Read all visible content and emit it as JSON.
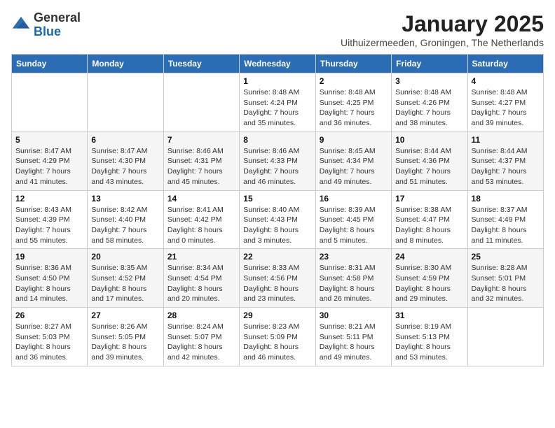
{
  "logo": {
    "general": "General",
    "blue": "Blue"
  },
  "header": {
    "month": "January 2025",
    "location": "Uithuizermeeden, Groningen, The Netherlands"
  },
  "weekdays": [
    "Sunday",
    "Monday",
    "Tuesday",
    "Wednesday",
    "Thursday",
    "Friday",
    "Saturday"
  ],
  "weeks": [
    [
      {
        "day": "",
        "info": ""
      },
      {
        "day": "",
        "info": ""
      },
      {
        "day": "",
        "info": ""
      },
      {
        "day": "1",
        "info": "Sunrise: 8:48 AM\nSunset: 4:24 PM\nDaylight: 7 hours\nand 35 minutes."
      },
      {
        "day": "2",
        "info": "Sunrise: 8:48 AM\nSunset: 4:25 PM\nDaylight: 7 hours\nand 36 minutes."
      },
      {
        "day": "3",
        "info": "Sunrise: 8:48 AM\nSunset: 4:26 PM\nDaylight: 7 hours\nand 38 minutes."
      },
      {
        "day": "4",
        "info": "Sunrise: 8:48 AM\nSunset: 4:27 PM\nDaylight: 7 hours\nand 39 minutes."
      }
    ],
    [
      {
        "day": "5",
        "info": "Sunrise: 8:47 AM\nSunset: 4:29 PM\nDaylight: 7 hours\nand 41 minutes."
      },
      {
        "day": "6",
        "info": "Sunrise: 8:47 AM\nSunset: 4:30 PM\nDaylight: 7 hours\nand 43 minutes."
      },
      {
        "day": "7",
        "info": "Sunrise: 8:46 AM\nSunset: 4:31 PM\nDaylight: 7 hours\nand 45 minutes."
      },
      {
        "day": "8",
        "info": "Sunrise: 8:46 AM\nSunset: 4:33 PM\nDaylight: 7 hours\nand 46 minutes."
      },
      {
        "day": "9",
        "info": "Sunrise: 8:45 AM\nSunset: 4:34 PM\nDaylight: 7 hours\nand 49 minutes."
      },
      {
        "day": "10",
        "info": "Sunrise: 8:44 AM\nSunset: 4:36 PM\nDaylight: 7 hours\nand 51 minutes."
      },
      {
        "day": "11",
        "info": "Sunrise: 8:44 AM\nSunset: 4:37 PM\nDaylight: 7 hours\nand 53 minutes."
      }
    ],
    [
      {
        "day": "12",
        "info": "Sunrise: 8:43 AM\nSunset: 4:39 PM\nDaylight: 7 hours\nand 55 minutes."
      },
      {
        "day": "13",
        "info": "Sunrise: 8:42 AM\nSunset: 4:40 PM\nDaylight: 7 hours\nand 58 minutes."
      },
      {
        "day": "14",
        "info": "Sunrise: 8:41 AM\nSunset: 4:42 PM\nDaylight: 8 hours\nand 0 minutes."
      },
      {
        "day": "15",
        "info": "Sunrise: 8:40 AM\nSunset: 4:43 PM\nDaylight: 8 hours\nand 3 minutes."
      },
      {
        "day": "16",
        "info": "Sunrise: 8:39 AM\nSunset: 4:45 PM\nDaylight: 8 hours\nand 5 minutes."
      },
      {
        "day": "17",
        "info": "Sunrise: 8:38 AM\nSunset: 4:47 PM\nDaylight: 8 hours\nand 8 minutes."
      },
      {
        "day": "18",
        "info": "Sunrise: 8:37 AM\nSunset: 4:49 PM\nDaylight: 8 hours\nand 11 minutes."
      }
    ],
    [
      {
        "day": "19",
        "info": "Sunrise: 8:36 AM\nSunset: 4:50 PM\nDaylight: 8 hours\nand 14 minutes."
      },
      {
        "day": "20",
        "info": "Sunrise: 8:35 AM\nSunset: 4:52 PM\nDaylight: 8 hours\nand 17 minutes."
      },
      {
        "day": "21",
        "info": "Sunrise: 8:34 AM\nSunset: 4:54 PM\nDaylight: 8 hours\nand 20 minutes."
      },
      {
        "day": "22",
        "info": "Sunrise: 8:33 AM\nSunset: 4:56 PM\nDaylight: 8 hours\nand 23 minutes."
      },
      {
        "day": "23",
        "info": "Sunrise: 8:31 AM\nSunset: 4:58 PM\nDaylight: 8 hours\nand 26 minutes."
      },
      {
        "day": "24",
        "info": "Sunrise: 8:30 AM\nSunset: 4:59 PM\nDaylight: 8 hours\nand 29 minutes."
      },
      {
        "day": "25",
        "info": "Sunrise: 8:28 AM\nSunset: 5:01 PM\nDaylight: 8 hours\nand 32 minutes."
      }
    ],
    [
      {
        "day": "26",
        "info": "Sunrise: 8:27 AM\nSunset: 5:03 PM\nDaylight: 8 hours\nand 36 minutes."
      },
      {
        "day": "27",
        "info": "Sunrise: 8:26 AM\nSunset: 5:05 PM\nDaylight: 8 hours\nand 39 minutes."
      },
      {
        "day": "28",
        "info": "Sunrise: 8:24 AM\nSunset: 5:07 PM\nDaylight: 8 hours\nand 42 minutes."
      },
      {
        "day": "29",
        "info": "Sunrise: 8:23 AM\nSunset: 5:09 PM\nDaylight: 8 hours\nand 46 minutes."
      },
      {
        "day": "30",
        "info": "Sunrise: 8:21 AM\nSunset: 5:11 PM\nDaylight: 8 hours\nand 49 minutes."
      },
      {
        "day": "31",
        "info": "Sunrise: 8:19 AM\nSunset: 5:13 PM\nDaylight: 8 hours\nand 53 minutes."
      },
      {
        "day": "",
        "info": ""
      }
    ]
  ]
}
